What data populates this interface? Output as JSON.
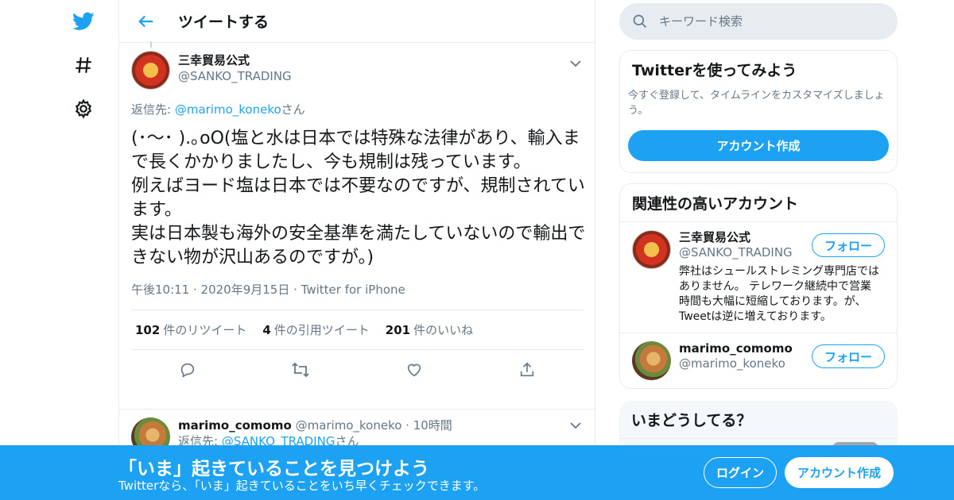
{
  "colors": {
    "accent": "#1da1f2",
    "muted": "#657786",
    "border": "#e6ecf0"
  },
  "nav": {
    "icons": [
      "twitter-bird-icon",
      "hashtag-icon",
      "gear-icon"
    ]
  },
  "header": {
    "title": "ツイートする"
  },
  "tweet": {
    "author_name": "三幸貿易公式",
    "author_handle": "@SANKO_TRADING",
    "reply_prefix": "返信先: ",
    "reply_user": "@marimo_koneko",
    "reply_suffix": "さん",
    "text": "(･〜･ ).｡oO(塩と水は日本では特殊な法律があり、輸入まで長くかかりましたし、今も規制は残っています。\n例えばヨード塩は日本では不要なのですが、規制されています。\n実は日本製も海外の安全基準を満たしていないので輸出できない物が沢山あるのですが。)",
    "time": "午後10:11",
    "date": "2020年9月15日",
    "source": "Twitter for iPhone",
    "stats": {
      "retweets_count": "102",
      "retweets_label": "件のリツイート",
      "quotes_count": "4",
      "quotes_label": "件の引用ツイート",
      "likes_count": "201",
      "likes_label": "件のいいね"
    }
  },
  "reply": {
    "name": "marimo_comomo",
    "handle": "@marimo_koneko",
    "time": "10時間",
    "reply_prefix": "返信先: ",
    "reply_user": "@SANKO_TRADING",
    "reply_suffix": "さん"
  },
  "search": {
    "placeholder": "キーワード検索"
  },
  "signup_card": {
    "title": "Twitterを使ってみよう",
    "desc": "今すぐ登録して、タイムラインをカスタマイズしましょう。",
    "button": "アカウント作成"
  },
  "related": {
    "title": "関連性の高いアカウント",
    "accounts": [
      {
        "name": "三幸貿易公式",
        "handle": "@SANKO_TRADING",
        "bio": "弊社はシュールストレミング専門店ではありません。 テレワーク継続中で営業時間も大幅に短縮しております。が、Tweetは逆に増えております。",
        "follow": "フォロー"
      },
      {
        "name": "marimo_comomo",
        "handle": "@marimo_koneko",
        "bio": "",
        "follow": "フォロー"
      }
    ]
  },
  "trends": {
    "title": "いまどうしてる？"
  },
  "banner": {
    "title": "「いま」起きていることを見つけよう",
    "sub": "Twitterなら、「いま」起きていることをいち早くチェックできます。",
    "login": "ログイン",
    "signup": "アカウント作成"
  }
}
